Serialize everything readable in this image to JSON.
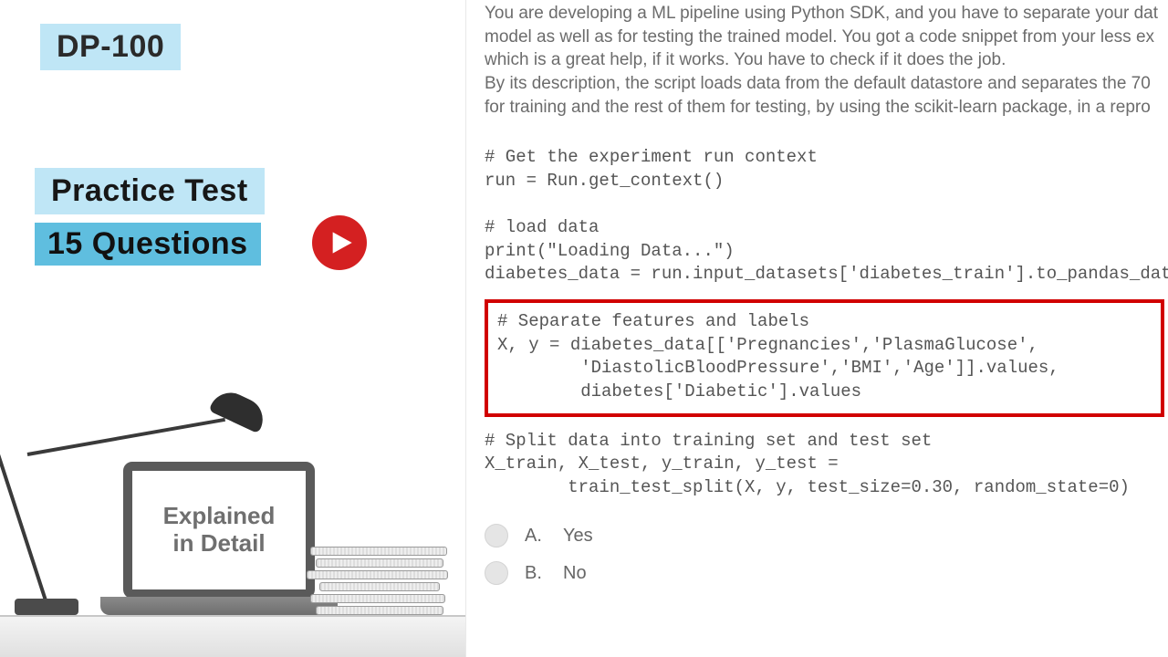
{
  "left": {
    "badge_dp": "DP-100",
    "badge_practice": "Practice Test",
    "badge_questions": "15 Questions",
    "screen_line1": "Explained",
    "screen_line2": "in Detail"
  },
  "right": {
    "intro_line1": "You are developing a ML pipeline using Python SDK, and you have to separate your dat",
    "intro_line2": "model as well as for testing the trained model. You got a code snippet from your less ex",
    "intro_line3": "which is a great help, if it works. You have to check if it does the job.",
    "intro_line4": "By its description, the script loads data from the default datastore and separates the 70",
    "intro_line5": "for training and the rest of them for testing, by using the scikit-learn package, in a repro",
    "code_block1": "# Get the experiment run context\nrun = Run.get_context()\n\n# load data\nprint(\"Loading Data...\")\ndiabetes_data = run.input_datasets['diabetes_train'].to_pandas_dataframe()",
    "code_highlight": "# Separate features and labels\nX, y = diabetes_data[['Pregnancies','PlasmaGlucose',\n        'DiastolicBloodPressure','BMI','Age']].values,\n        diabetes['Diabetic'].values",
    "code_block2": "# Split data into training set and test set\nX_train, X_test, y_train, y_test =\n        train_test_split(X, y, test_size=0.30, random_state=0)",
    "answers": [
      {
        "label": "A.",
        "text": "Yes"
      },
      {
        "label": "B.",
        "text": "No"
      }
    ]
  }
}
